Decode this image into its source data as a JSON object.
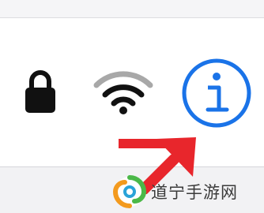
{
  "status_icons": {
    "lock": "lock-icon",
    "wifi": "wifi-icon",
    "info": "info-icon"
  },
  "overlay": {
    "arrow": "arrow-icon",
    "arrow_color": "#e8262c"
  },
  "watermark": {
    "text": "道宁手游网",
    "logo": "swirl-logo"
  },
  "colors": {
    "info_accent": "#1a73e8",
    "icon_dark": "#111111",
    "wifi_faded": "#9a9a9a"
  }
}
